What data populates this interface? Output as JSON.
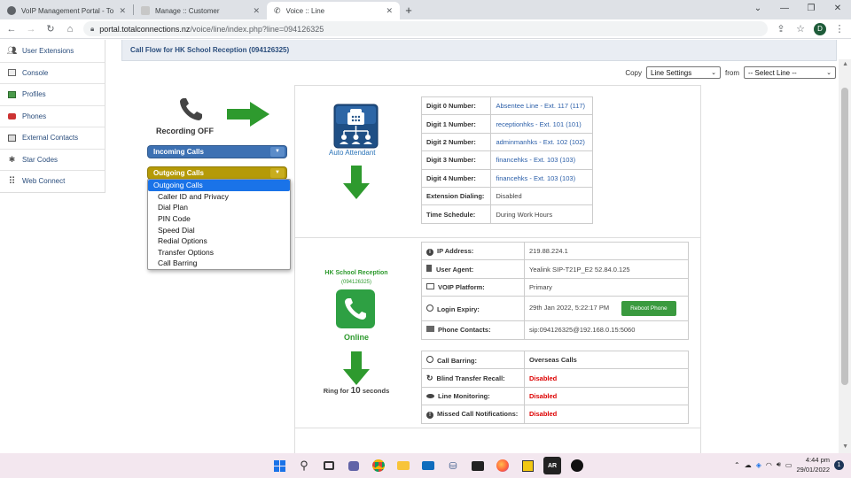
{
  "browser": {
    "tabs": [
      {
        "title": "VoIP Management Portal - Total C",
        "active": false
      },
      {
        "title": "Manage :: Customer",
        "active": false
      },
      {
        "title": "Voice :: Line",
        "active": true
      }
    ],
    "url_host": "portal.totalconnections.nz",
    "url_path": "/voice/line/index.php?line=094126325",
    "profile_initial": "D",
    "window_controls": [
      "⌄",
      "—",
      "❐",
      "✕"
    ]
  },
  "sidebar": {
    "items": [
      {
        "label": "User Extensions",
        "icon": "users-icon"
      },
      {
        "label": "Console",
        "icon": "console-icon"
      },
      {
        "label": "Profiles",
        "icon": "profiles-icon"
      },
      {
        "label": "Phones",
        "icon": "phone-icon"
      },
      {
        "label": "External Contacts",
        "icon": "contacts-icon"
      },
      {
        "label": "Star Codes",
        "icon": "star-icon"
      },
      {
        "label": "Web Connect",
        "icon": "grid-icon"
      }
    ]
  },
  "header": {
    "title": "Call Flow for HK School Reception (094126325)"
  },
  "copy": {
    "copy_label": "Copy",
    "copy_value": "Line Settings",
    "from_label": "from",
    "from_value": "-- Select Line --"
  },
  "recording": {
    "label": "Recording OFF"
  },
  "dropdowns": {
    "incoming": "Incoming Calls",
    "outgoing": "Outgoing Calls",
    "options": [
      "Outgoing Calls",
      "Caller ID and Privacy",
      "Dial Plan",
      "PIN Code",
      "Speed Dial",
      "Redial Options",
      "Transfer Options",
      "Call Barring"
    ],
    "selected_index": 0
  },
  "auto_attendant": {
    "label": "Auto Attendant",
    "rows": [
      {
        "key": "Digit 0 Number:",
        "value": "Absentee Line - Ext. 117 (117)"
      },
      {
        "key": "Digit 1 Number:",
        "value": "receptionhks - Ext. 101 (101)"
      },
      {
        "key": "Digit 2 Number:",
        "value": "adminmanhks - Ext. 102 (102)"
      },
      {
        "key": "Digit 3 Number:",
        "value": "financehks - Ext. 103 (103)"
      },
      {
        "key": "Digit 4 Number:",
        "value": "financehks - Ext. 103 (103)"
      },
      {
        "key": "Extension Dialing:",
        "value": "Disabled"
      },
      {
        "key": "Time Schedule:",
        "value": "During Work Hours"
      }
    ]
  },
  "extension": {
    "name": "HK School Reception",
    "number": "(094126325)",
    "status": "Online",
    "ring_prefix": "Ring for",
    "ring_seconds": "10",
    "ring_suffix": "seconds"
  },
  "device": {
    "rows": [
      {
        "icon": "info-icon",
        "key": "IP Address:",
        "value": "219.88.224.1"
      },
      {
        "icon": "agent-icon",
        "key": "User Agent:",
        "value": "Yealink SIP-T21P_E2 52.84.0.125"
      },
      {
        "icon": "monitor-icon",
        "key": "VOIP Platform:",
        "value": "Primary"
      },
      {
        "icon": "clock-icon",
        "key": "Login Expiry:",
        "value": "29th Jan 2022, 5:22:17 PM"
      },
      {
        "icon": "contact-card-icon",
        "key": "Phone Contacts:",
        "value": "sip:094126325@192.168.0.15:5060"
      }
    ],
    "reboot_label": "Reboot Phone"
  },
  "features": {
    "rows": [
      {
        "icon": "barring-icon",
        "key": "Call Barring:",
        "value": "Overseas Calls"
      },
      {
        "icon": "recall-icon",
        "key": "Blind Transfer Recall:",
        "value": "Disabled"
      },
      {
        "icon": "eye-icon",
        "key": "Line Monitoring:",
        "value": "Disabled"
      },
      {
        "icon": "alert-icon",
        "key": "Missed Call Notifications:",
        "value": "Disabled"
      }
    ]
  },
  "taskbar": {
    "time": "4:44 pm",
    "date": "29/01/2022",
    "notifications": "1",
    "ar_label": "AR"
  },
  "colors": {
    "incoming": "#3d71b3",
    "outgoing": "#b59a07",
    "green": "#2e9a2e",
    "link": "#2a5ea8",
    "danger": "#dd0000"
  }
}
